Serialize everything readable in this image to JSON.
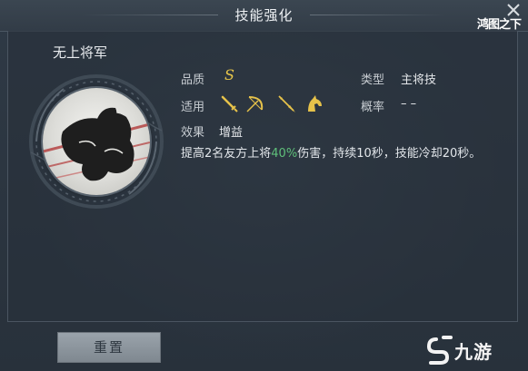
{
  "header": {
    "title": "技能强化",
    "logo_text": "鸿图之下"
  },
  "skill": {
    "name": "无上将军",
    "quality_label": "品质",
    "quality_value": "S",
    "type_label": "类型",
    "type_value": "主将技",
    "applicable_label": "适用",
    "applicable_icons": [
      "sword-icon",
      "bow-icon",
      "spear-icon",
      "horse-icon"
    ],
    "probability_label": "概率",
    "probability_value": "– –",
    "effect_label": "效果",
    "effect_value": "增益",
    "description_before": "提高2名友方上将",
    "description_highlight": "40%",
    "description_after": "伤害，持续10秒，技能冷却20秒。",
    "highlight_color": "#5fc07a",
    "quality_color": "#e8c64a"
  },
  "footer": {
    "reset_label": "重置",
    "watermark_text": "九游"
  }
}
